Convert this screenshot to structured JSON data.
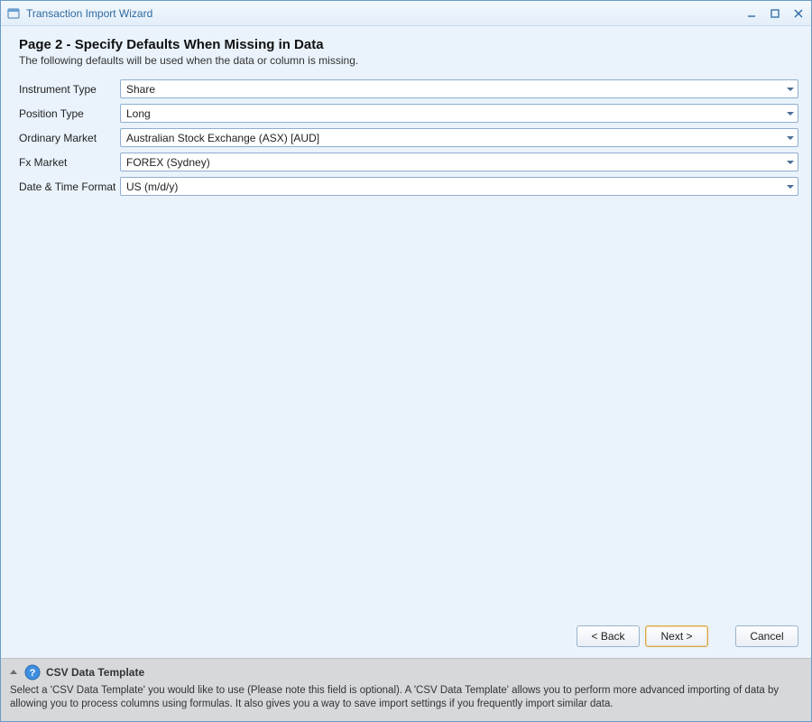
{
  "window": {
    "title": "Transaction Import Wizard"
  },
  "heading": {
    "title": "Page 2 - Specify Defaults When Missing in Data",
    "subtitle": "The following defaults will be used when the data or column is missing."
  },
  "form": {
    "instrument_type": {
      "label": "Instrument Type",
      "value": "Share"
    },
    "position_type": {
      "label": "Position Type",
      "value": "Long"
    },
    "ordinary_market": {
      "label": "Ordinary Market",
      "value": "Australian Stock Exchange (ASX) [AUD]"
    },
    "fx_market": {
      "label": "Fx Market",
      "value": "FOREX (Sydney)"
    },
    "date_format": {
      "label": "Date & Time Format",
      "value": "US (m/d/y)"
    }
  },
  "buttons": {
    "back": "< Back",
    "next": "Next >",
    "cancel": "Cancel"
  },
  "help": {
    "title": "CSV Data Template",
    "body": "Select a 'CSV Data Template' you would like to use (Please note this field is optional). A 'CSV Data Template' allows you to perform more advanced importing of data by allowing you to process columns using formulas. It also gives you a way to save import settings if you frequently import similar data."
  }
}
